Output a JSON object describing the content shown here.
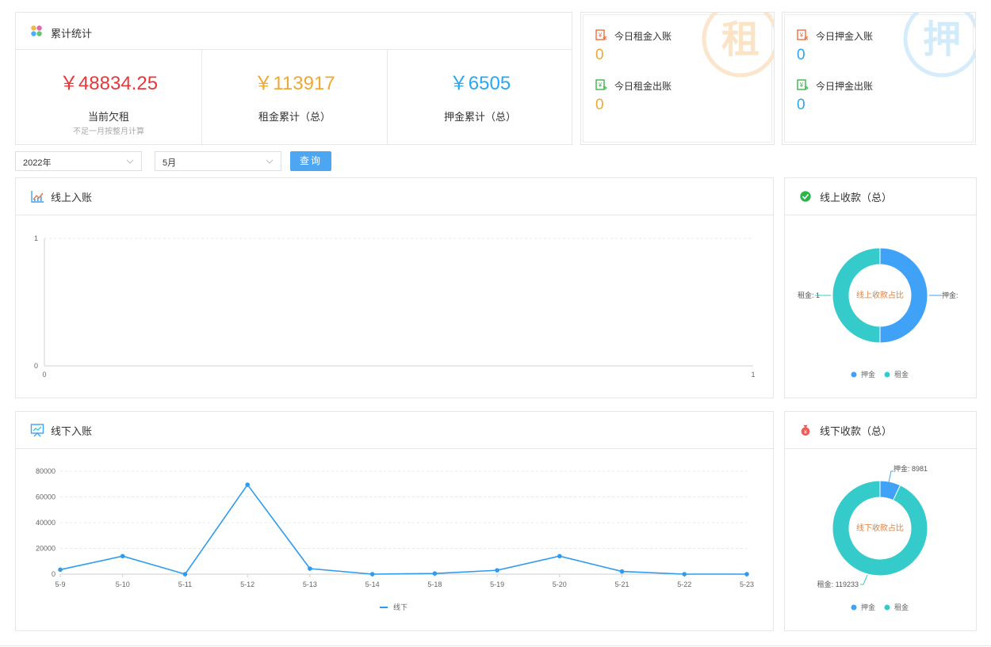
{
  "summary": {
    "title": "累计统计",
    "stats": [
      {
        "value": "￥48834.25",
        "label": "当前欠租",
        "note": "不足一月按整月计算",
        "color": "#e8383b"
      },
      {
        "value": "￥113917",
        "label": "租金累计（总）",
        "note": "",
        "color": "#f0a834"
      },
      {
        "value": "￥6505",
        "label": "押金累计（总）",
        "note": "",
        "color": "#28a8f2"
      }
    ]
  },
  "rent_today": {
    "watermark": "租",
    "in_label": "今日租金入账",
    "in_value": "0",
    "out_label": "今日租金出账",
    "out_value": "0",
    "value_color": "#f0a834"
  },
  "deposit_today": {
    "watermark": "押",
    "in_label": "今日押金入账",
    "in_value": "0",
    "out_label": "今日押金出账",
    "out_value": "0",
    "value_color": "#28a8f2"
  },
  "filters": {
    "year": "2022年",
    "month": "5月",
    "query_button": "查询"
  },
  "online": {
    "title": "线上入账",
    "chart": {
      "type": "line",
      "y_ticks": [
        "1",
        "0"
      ],
      "x_ticks": [
        "0",
        "1"
      ]
    },
    "donut_title": "线上收款（总）",
    "donut": {
      "center": "线上收款占比",
      "left_label": "租金: 1",
      "right_label": "押金:",
      "legend": [
        "押金",
        "租金"
      ]
    }
  },
  "offline": {
    "title": "线下入账",
    "donut_title": "线下收款（总）",
    "donut": {
      "center": "线下收款占比",
      "deposit_label": "押金: 8981",
      "rent_label": "租金: 119233",
      "legend": [
        "押金",
        "租金"
      ]
    }
  },
  "colors": {
    "deposit": "#3fa2f7",
    "rent": "#36cbcb",
    "line": "#2d9bf0",
    "center_text": "#e07f3a"
  },
  "chart_data": [
    {
      "type": "line",
      "title": "线上入账",
      "x": [],
      "series": [],
      "xlim": [
        0,
        1
      ],
      "ylim": [
        0,
        1
      ],
      "grid": true
    },
    {
      "type": "pie",
      "title": "线上收款（总）",
      "categories": [
        "押金",
        "租金"
      ],
      "values": [
        1,
        1
      ],
      "center_text": "线上收款占比",
      "legend": "bottom"
    },
    {
      "type": "line",
      "title": "线下入账",
      "categories": [
        "5-9",
        "5-10",
        "5-11",
        "5-12",
        "5-13",
        "5-14",
        "5-18",
        "5-19",
        "5-20",
        "5-21",
        "5-22",
        "5-23"
      ],
      "series": [
        {
          "name": "线下",
          "values": [
            3500,
            14000,
            0,
            69500,
            4300,
            0,
            500,
            3000,
            14000,
            2100,
            0,
            0
          ]
        }
      ],
      "y_ticks": [
        0,
        20000,
        40000,
        60000,
        80000
      ],
      "ylim": [
        0,
        80000
      ],
      "grid": true,
      "legend": "bottom"
    },
    {
      "type": "pie",
      "title": "线下收款（总）",
      "categories": [
        "押金",
        "租金"
      ],
      "values": [
        8981,
        119233
      ],
      "center_text": "线下收款占比",
      "legend": "bottom"
    }
  ]
}
